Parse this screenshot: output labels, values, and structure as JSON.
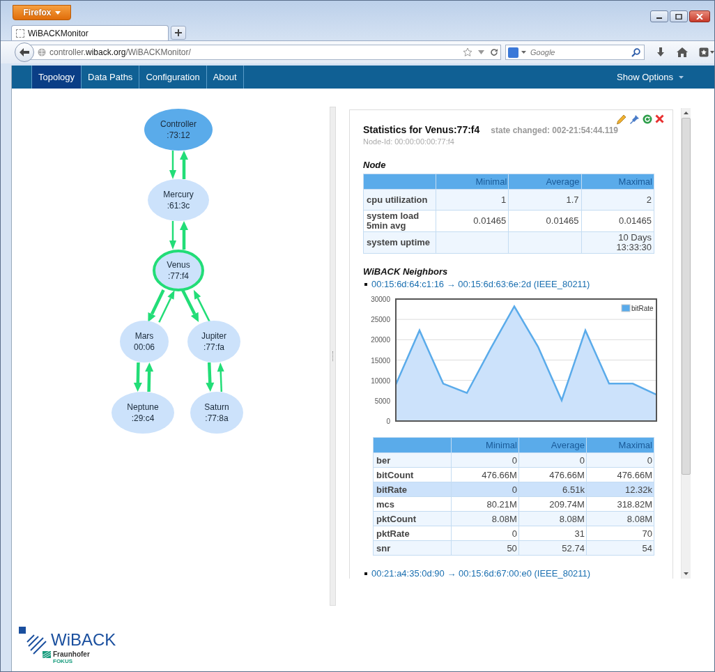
{
  "browser": {
    "menu_button": "Firefox",
    "tab_title": "WiBACKMonitor",
    "url": {
      "prefix": "controller.",
      "host": "wiback.org",
      "path": "/WiBACKMonitor/"
    },
    "search": {
      "placeholder": "Google"
    }
  },
  "nav": {
    "items": [
      {
        "label": "Topology",
        "selected": true
      },
      {
        "label": "Data Paths",
        "selected": false
      },
      {
        "label": "Configuration",
        "selected": false
      },
      {
        "label": "About",
        "selected": false
      }
    ],
    "options": "Show Options"
  },
  "topology": {
    "nodes": [
      {
        "name": "Controller",
        "id": ":73:12",
        "kind": "controller",
        "selected": false
      },
      {
        "name": "Mercury",
        "id": ":61:3c",
        "kind": "node",
        "selected": false
      },
      {
        "name": "Venus",
        "id": ":77:f4",
        "kind": "node",
        "selected": true
      },
      {
        "name": "Mars",
        "id": "00:06",
        "kind": "node",
        "selected": false
      },
      {
        "name": "Jupiter",
        "id": ":77:fa",
        "kind": "node",
        "selected": false
      },
      {
        "name": "Neptune",
        "id": ":29:c4",
        "kind": "node",
        "selected": false
      },
      {
        "name": "Saturn",
        "id": ":77:8a",
        "kind": "node",
        "selected": false
      }
    ],
    "edges": [
      {
        "thick": false
      },
      {
        "thick": true
      },
      {
        "thick": false
      },
      {
        "thick": true
      },
      {
        "thick": true
      },
      {
        "thick": false
      },
      {
        "thick": true
      },
      {
        "thick": false
      },
      {
        "thick": true
      },
      {
        "thick": true
      },
      {
        "thick": true
      },
      {
        "thick": false
      }
    ]
  },
  "stats": {
    "title": "Statistics for Venus:77:f4",
    "state": "state changed: 002-21:54:44.119",
    "node_id": "Node-Id: 00:00:00:00:77:f4",
    "node_heading": "Node",
    "node_table": {
      "columns": [
        "Minimal",
        "Average",
        "Maximal"
      ],
      "rows": [
        {
          "label": "cpu utilization",
          "minimal": "1",
          "average": "1.7",
          "maximal": "2"
        },
        {
          "label": "system load 5min avg",
          "minimal": "0.01465",
          "average": "0.01465",
          "maximal": "0.01465"
        },
        {
          "label": "system uptime",
          "maximal": "10 Days 13:33:30"
        }
      ]
    },
    "neighbors_heading": "WiBACK Neighbors",
    "neighbors": [
      {
        "link": "00:15:6d:64:c1:16 → 00:15:6d:63:6e:2d (IEEE_80211)",
        "chart_data": {
          "type": "area",
          "grid": true,
          "ylim": [
            0,
            30000
          ],
          "yticks": [
            0,
            5000,
            10000,
            15000,
            20000,
            25000,
            30000
          ],
          "series": [
            {
              "name": "bitRate",
              "color": "#5aabea",
              "values": [
                9000,
                22300,
                9200,
                6900,
                17800,
                28200,
                18300,
                5100,
                22300,
                9200,
                9200,
                6500
              ]
            }
          ]
        },
        "table": {
          "columns": [
            "Minimal",
            "Average",
            "Maximal"
          ],
          "rows": [
            {
              "label": "ber",
              "minimal": "0",
              "average": "0",
              "maximal": "0",
              "selected": false
            },
            {
              "label": "bitCount",
              "minimal": "476.66M",
              "average": "476.66M",
              "maximal": "476.66M",
              "selected": false
            },
            {
              "label": "bitRate",
              "minimal": "0",
              "average": "6.51k",
              "maximal": "12.32k",
              "selected": true
            },
            {
              "label": "mcs",
              "minimal": "80.21M",
              "average": "209.74M",
              "maximal": "318.82M",
              "selected": false
            },
            {
              "label": "pktCount",
              "minimal": "8.08M",
              "average": "8.08M",
              "maximal": "8.08M",
              "selected": false
            },
            {
              "label": "pktRate",
              "minimal": "0",
              "average": "31",
              "maximal": "70",
              "selected": false
            },
            {
              "label": "snr",
              "minimal": "50",
              "average": "52.74",
              "maximal": "54",
              "selected": false
            }
          ]
        }
      },
      {
        "link": "00:21:a4:35:0d:90 → 00:15:6d:67:00:e0 (IEEE_80211)"
      }
    ]
  },
  "logo": {
    "name": "WiBACK",
    "org": "Fraunhofer",
    "unit": "FOKUS"
  }
}
